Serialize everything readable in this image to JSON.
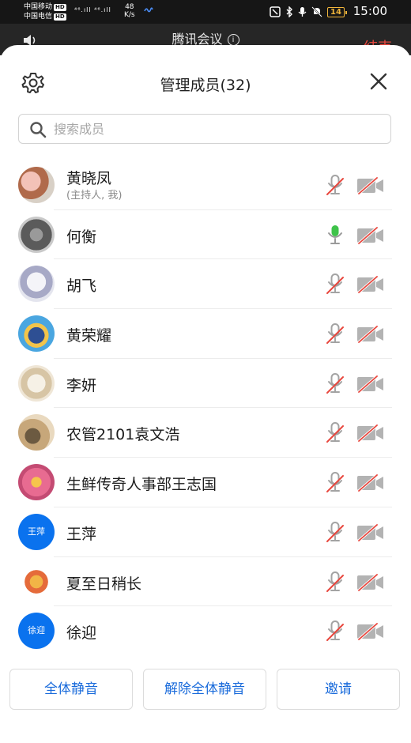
{
  "status_bar": {
    "carrier1": "中国移动",
    "carrier2": "中国电信",
    "hd": "HD",
    "signal": "⁴⁶.ıll ⁴⁶.ıll",
    "speed_value": "48",
    "speed_unit": "K/s",
    "battery": "14",
    "time": "15:00"
  },
  "meeting": {
    "title": "腾讯会议",
    "end_label": "结束"
  },
  "panel": {
    "title": "管理成员(32)",
    "search_placeholder": "搜索成员"
  },
  "members": [
    {
      "name": "黄晓凤",
      "sub": "(主持人, 我)",
      "avatar": "photo",
      "mic": "muted",
      "camera": "off"
    },
    {
      "name": "何衡",
      "avatar": "photo",
      "mic": "on",
      "camera": "off"
    },
    {
      "name": "胡飞",
      "avatar": "photo",
      "mic": "muted",
      "camera": "off"
    },
    {
      "name": "黄荣耀",
      "avatar": "photo",
      "mic": "muted",
      "camera": "off"
    },
    {
      "name": "李妍",
      "avatar": "photo",
      "mic": "muted",
      "camera": "off"
    },
    {
      "name": "农管2101袁文浩",
      "avatar": "photo",
      "mic": "muted",
      "camera": "off"
    },
    {
      "name": "生鲜传奇人事部王志国",
      "avatar": "photo",
      "mic": "muted",
      "camera": "off"
    },
    {
      "name": "王萍",
      "avatar_text": "王萍",
      "mic": "muted",
      "camera": "off"
    },
    {
      "name": "夏至日稍长",
      "avatar": "photo",
      "mic": "muted",
      "camera": "off"
    },
    {
      "name": "徐迎",
      "avatar_text": "徐迎",
      "mic": "muted",
      "camera": "off"
    }
  ],
  "buttons": {
    "mute_all": "全体静音",
    "unmute_all": "解除全体静音",
    "invite": "邀请"
  },
  "colors": {
    "accent": "#1a6bdb",
    "muted_slash": "#e8483f",
    "mic_on": "#3fc34a",
    "avatar_blue": "#0a72ee"
  }
}
